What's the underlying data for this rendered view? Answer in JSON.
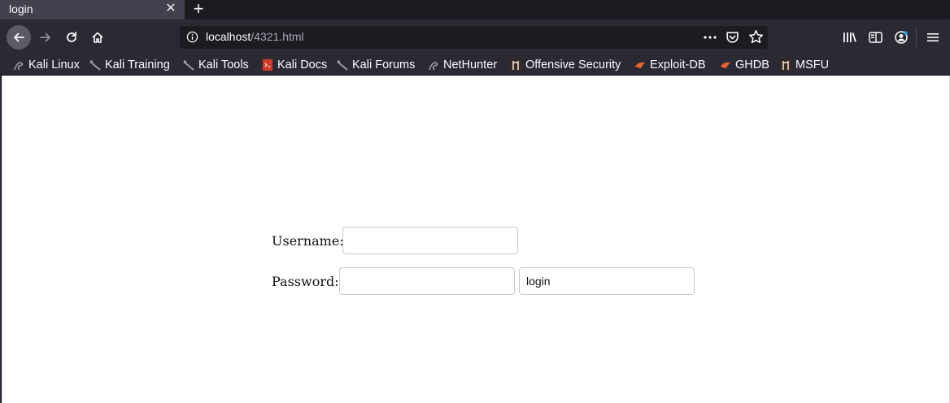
{
  "tab": {
    "title": "login",
    "close_icon": "close-icon",
    "new_tab_icon": "plus-icon"
  },
  "navbar": {
    "url_host": "localhost",
    "url_path": "/4321.html"
  },
  "bookmarks": [
    {
      "label": "Kali Linux",
      "icon": "kali-dragon-icon"
    },
    {
      "label": "Kali Training",
      "icon": "kali-sword-icon"
    },
    {
      "label": "Kali Tools",
      "icon": "kali-sword-icon"
    },
    {
      "label": "Kali Docs",
      "icon": "red-docs-icon"
    },
    {
      "label": "Kali Forums",
      "icon": "kali-sword-icon"
    },
    {
      "label": "NetHunter",
      "icon": "kali-dragon-icon"
    },
    {
      "label": "Offensive Security",
      "icon": "offsec-icon"
    },
    {
      "label": "Exploit-DB",
      "icon": "exploit-db-icon"
    },
    {
      "label": "GHDB",
      "icon": "exploit-db-icon"
    },
    {
      "label": "MSFU",
      "icon": "offsec-icon"
    }
  ],
  "form": {
    "username_label": "Username:",
    "username_value": "",
    "password_label": "Password:",
    "password_value": "",
    "submit_value": "login"
  }
}
